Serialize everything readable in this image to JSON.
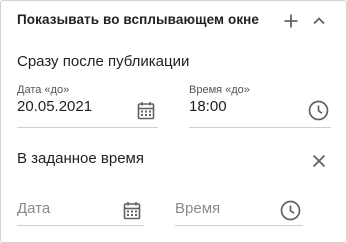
{
  "header": {
    "title": "Показывать во всплывающем окне"
  },
  "section_after_publication": {
    "title": "Сразу после публикации",
    "date_field": {
      "label": "Дата «до»",
      "value": "20.05.2021"
    },
    "time_field": {
      "label": "Время «до»",
      "value": "18:00"
    }
  },
  "section_scheduled": {
    "title": "В заданное время",
    "date_field": {
      "placeholder": "Дата"
    },
    "time_field": {
      "placeholder": "Время"
    }
  },
  "icons": {
    "add": "plus-icon",
    "collapse": "chevron-up-icon",
    "calendar": "calendar-icon",
    "clock": "clock-icon",
    "clear": "close-icon"
  },
  "colors": {
    "text": "#222222",
    "icon": "#5f6368",
    "border": "#d4d4d4",
    "placeholder": "#8a8a8a"
  }
}
